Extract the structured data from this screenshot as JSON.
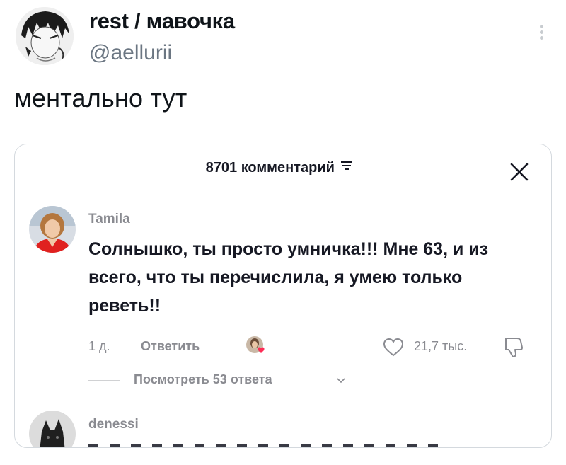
{
  "tweet": {
    "display_name": "rest / мавочка",
    "handle": "@aellurii",
    "text": "ментально тут"
  },
  "comments_panel": {
    "count_label": "8701 комментарий",
    "comments": [
      {
        "author": "Tamila",
        "text": "Солнышко, ты просто умничка!!! Мне 63, и из всего, что ты перечислила, я умею только реветь!!",
        "time_ago": "1 д.",
        "reply_label": "Ответить",
        "like_count": "21,7 тыс.",
        "view_replies_label": "Посмотреть 53 ответа"
      },
      {
        "author": "denessi"
      }
    ]
  },
  "icons": {
    "more": "more-vertical-icon",
    "filter": "filter-icon",
    "close": "close-icon",
    "like": "heart-outline-icon",
    "dislike": "thumbs-down-icon",
    "chevron": "chevron-down-icon",
    "creator_liked": "creator-liked-heart-icon"
  },
  "colors": {
    "text_primary": "#0f1419",
    "text_secondary": "#6b7682",
    "comment_text": "#161823",
    "meta_gray": "#8a8b91",
    "creator_heart": "#fe2c55",
    "card_border": "#d4d9de"
  }
}
